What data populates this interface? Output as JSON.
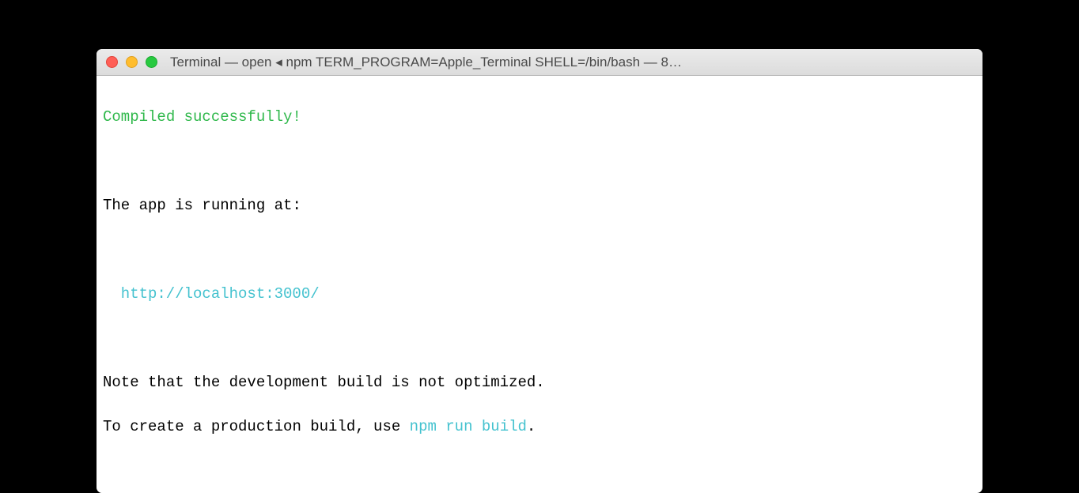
{
  "window": {
    "title": "Terminal — open ◂ npm TERM_PROGRAM=Apple_Terminal SHELL=/bin/bash — 8…"
  },
  "output": {
    "compiled": "Compiled successfully!",
    "running_at_label": "The app is running at:",
    "url": "http://localhost:3000/",
    "note_line": "Note that the development build is not optimized.",
    "prod_prefix": "To create a production build, use ",
    "prod_cmd": "npm run build",
    "prod_suffix": "."
  },
  "colors": {
    "green": "#2fb84b",
    "cyan": "#44c2cf"
  }
}
